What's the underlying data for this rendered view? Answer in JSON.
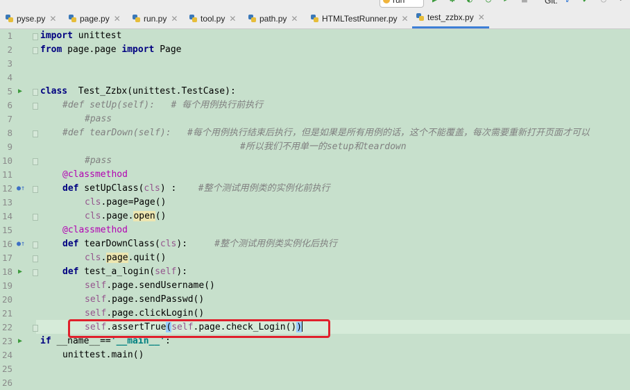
{
  "toolbar": {
    "run_config": "run",
    "git_label": "Git:",
    "icons": [
      "run-icon",
      "debug-icon",
      "coverage-icon",
      "profile-icon",
      "run-with-icon",
      "stop-icon",
      "vcs-update-icon",
      "vcs-commit-icon",
      "history-icon",
      "revert-icon"
    ]
  },
  "tabs": [
    {
      "label": "pyse.py",
      "active": false
    },
    {
      "label": "page.py",
      "active": false
    },
    {
      "label": "run.py",
      "active": false
    },
    {
      "label": "tool.py",
      "active": false
    },
    {
      "label": "path.py",
      "active": false
    },
    {
      "label": "HTMLTestRunner.py",
      "active": false
    },
    {
      "label": "test_zzbx.py",
      "active": true
    }
  ],
  "editor": {
    "line_numbers": [
      "1",
      "2",
      "3",
      "4",
      "5",
      "6",
      "7",
      "8",
      "9",
      "10",
      "11",
      "12",
      "13",
      "14",
      "15",
      "16",
      "17",
      "18",
      "19",
      "20",
      "21",
      "22",
      "23",
      "24",
      "25",
      "26"
    ],
    "current_line": 22,
    "highlighted_line": 22,
    "lines": {
      "l1a": "import",
      "l1b": " unittest",
      "l2a": "from",
      "l2b": " page.page ",
      "l2c": "import",
      "l2d": " Page",
      "l5a": "class",
      "l5b": "  Test_Zzbx(unittest.TestCase):",
      "l6": "#def setUp(self):   # 每个用例执行前执行",
      "l7": "#pass",
      "l8": "#def tearDown(self):   #每个用例执行结束后执行，但是如果是所有用例的话，这个不能覆盖，每次需要重新打开页面才可以",
      "l9": "#所以我们不用单一的setup和teardown",
      "l10": "#pass",
      "l11": "@classmethod",
      "l12a": "def",
      "l12b": " setUpClass(",
      "l12c": "cls",
      "l12d": ") :    ",
      "l12e": "#整个测试用例类的实例化前执行",
      "l13a": "cls",
      "l13b": ".page=Page()",
      "l14a": "cls",
      "l14b": ".page.",
      "l14c": "open",
      "l14d": "()",
      "l15": "@classmethod",
      "l16a": "def",
      "l16b": " tearDownClass(",
      "l16c": "cls",
      "l16d": "):     ",
      "l16e": "#整个测试用例类实例化后执行",
      "l17a": "cls",
      "l17b": ".",
      "l17c": "page",
      "l17d": ".quit()",
      "l18a": "def",
      "l18b": " test_a_login(",
      "l18c": "self",
      "l18d": "):",
      "l19a": "self",
      "l19b": ".page.sendUsername()",
      "l20a": "self",
      "l20b": ".page.sendPasswd()",
      "l21a": "self",
      "l21b": ".page.clickLogin()",
      "l22a": "self",
      "l22b": ".assertTrue",
      "l22c": "(",
      "l22d": "self",
      "l22e": ".page.check_Login()",
      "l22f": ")",
      "l23a": "if",
      "l23b": " __name__==",
      "l23c": "'__main__'",
      "l23d": ":",
      "l24": "unittest.main()"
    }
  },
  "colors": {
    "editor_bg": "#c7e0cc",
    "keyword": "#000080",
    "comment": "#808080",
    "self": "#94558d",
    "decorator": "#b200b2",
    "annotation_box": "#e0202c",
    "active_tab_underline": "#3d7fd6"
  }
}
